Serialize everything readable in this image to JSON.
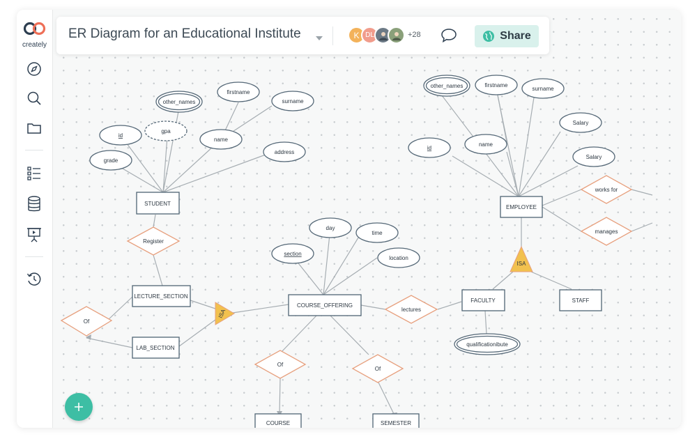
{
  "app": {
    "logo_text": "creately",
    "brand_color": "#3dbea4"
  },
  "sidebar": {
    "items": [
      {
        "name": "compass-icon"
      },
      {
        "name": "search-icon"
      },
      {
        "name": "folder-icon"
      },
      {
        "name": "task-list-icon"
      },
      {
        "name": "database-icon"
      },
      {
        "name": "presentation-icon"
      },
      {
        "name": "history-icon"
      }
    ]
  },
  "header": {
    "title": "ER Diagram for an Educational Institute",
    "collaborators": [
      {
        "initial": "K",
        "color": "#f3b25a"
      },
      {
        "initial": "DL",
        "color": "#f19c8c"
      },
      {
        "initial": "",
        "color": "#6c7a86"
      },
      {
        "initial": "",
        "color": "#8aa07a"
      }
    ],
    "more_count": "+28",
    "share_label": "Share"
  },
  "diagram": {
    "entities": {
      "student": "STUDENT",
      "lecture_section": "LECTURE_SECTION",
      "lab_section": "LAB_SECTION",
      "course_offering": "COURSE_OFFERING",
      "course": "COURSE",
      "semester": "SEMESTER",
      "employee": "EMPLOYEE",
      "faculty": "FACULTY",
      "staff": "STAFF"
    },
    "attributes": {
      "student_other_names": "other_names",
      "student_firstname": "firstname",
      "student_surname": "surname",
      "student_id": "id",
      "student_gpa": "gpa",
      "student_name": "name",
      "student_grade": "grade",
      "student_address": "address",
      "co_day": "day",
      "co_time": "time",
      "co_section": "section",
      "co_location": "location",
      "emp_other_names": "other_names",
      "emp_firstname": "firstname",
      "emp_surname": "surname",
      "emp_salary1": "Salary",
      "emp_id": "id",
      "emp_name": "name",
      "emp_salary2": "Salary",
      "fac_qualification": "qualificationibute"
    },
    "relationships": {
      "register": "Register",
      "of_left": "Of",
      "lectures": "lectures",
      "of_course": "Of",
      "of_semester": "Of",
      "works_for": "works for",
      "manages": "manages"
    },
    "isa": {
      "left": "ISA",
      "right": "ISA"
    },
    "colors": {
      "entity_stroke": "#4f6474",
      "relationship_stroke": "#e7a07e",
      "isa_fill": "#f2c14e"
    }
  }
}
